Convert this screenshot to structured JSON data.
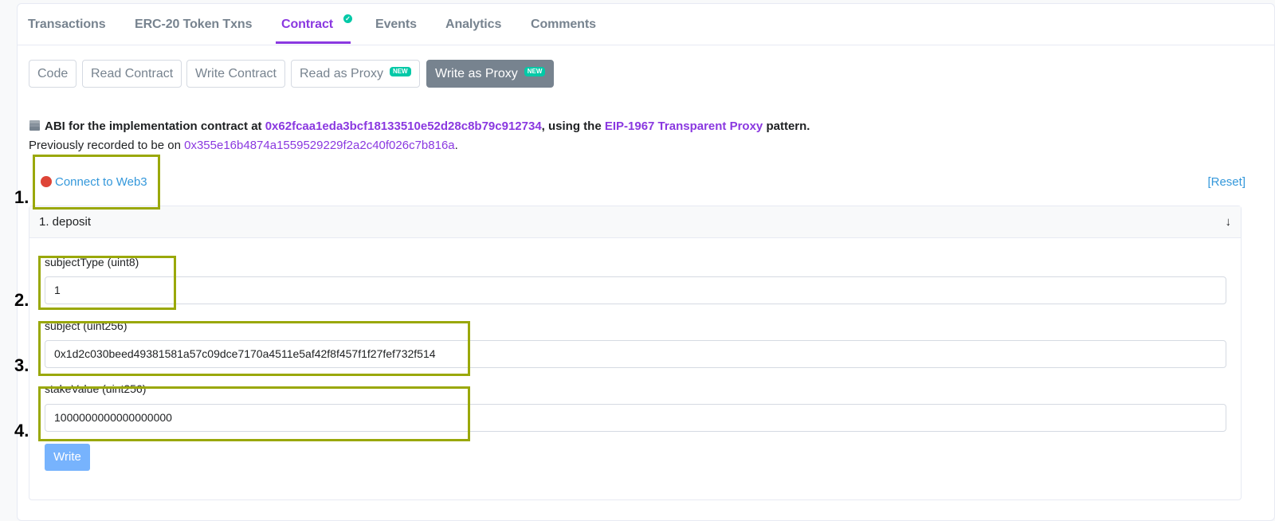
{
  "tabs": [
    {
      "label": "Transactions",
      "active": false
    },
    {
      "label": "ERC-20 Token Txns",
      "active": false
    },
    {
      "label": "Contract",
      "active": true,
      "verified": true
    },
    {
      "label": "Events",
      "active": false
    },
    {
      "label": "Analytics",
      "active": false
    },
    {
      "label": "Comments",
      "active": false
    }
  ],
  "subtabs": [
    {
      "label": "Code",
      "active": false
    },
    {
      "label": "Read Contract",
      "active": false
    },
    {
      "label": "Write Contract",
      "active": false
    },
    {
      "label": "Read as Proxy",
      "badge": "NEW",
      "active": false
    },
    {
      "label": "Write as Proxy",
      "badge": "NEW",
      "active": true
    }
  ],
  "abi": {
    "prefix": "ABI for the implementation contract at ",
    "implementation_address": "0x62fcaa1eda3bcf18133510e52d28c8b79c912734",
    "middle": ", using the ",
    "pattern_link": "EIP-1967 Transparent Proxy",
    "suffix": " pattern.",
    "previous_prefix": "Previously recorded to be on ",
    "previous_address": "0x355e16b4874a1559529229f2a2c40f026c7b816a",
    "previous_suffix": "."
  },
  "connect_label": "Connect to Web3",
  "reset_label": "[Reset]",
  "function": {
    "title": "1. deposit",
    "arrow": "↓",
    "inputs": [
      {
        "label": "subjectType (uint8)",
        "value": "1"
      },
      {
        "label": "subject (uint256)",
        "value": "0x1d2c030beed49381581a57c09dce7170a4511e5af42f8f457f1f27fef732f514"
      },
      {
        "label": "stakeValue (uint256)",
        "value": "1000000000000000000"
      }
    ],
    "write_label": "Write"
  },
  "annotations": [
    "1.",
    "2.",
    "3.",
    "4."
  ],
  "colors": {
    "accent": "#8a38e0",
    "link": "#3498db",
    "highlight": "#9aa80a",
    "badge": "#00c9a7"
  }
}
